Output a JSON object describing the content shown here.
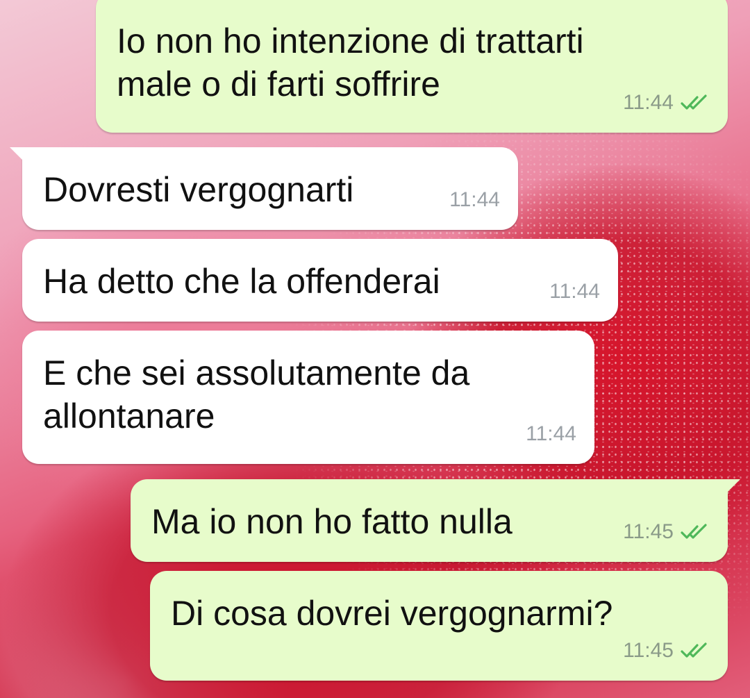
{
  "messages": [
    {
      "direction": "outgoing",
      "text": "Io non ho intenzione di trattarti\nmale o di farti soffrire",
      "time": "11:44",
      "status": "read"
    },
    {
      "direction": "incoming",
      "text": "Dovresti vergognarti",
      "time": "11:44"
    },
    {
      "direction": "incoming",
      "text": "Ha detto che la offenderai",
      "time": "11:44"
    },
    {
      "direction": "incoming",
      "text": "E che sei assolutamente da\nallontanare",
      "time": "11:44"
    },
    {
      "direction": "outgoing",
      "text": "Ma io non ho fatto nulla",
      "time": "11:45",
      "status": "read"
    },
    {
      "direction": "outgoing",
      "text": "Di cosa dovrei vergognarmi?",
      "time": "11:45",
      "status": "read"
    }
  ],
  "colors": {
    "outgoing_bubble": "#e7fccb",
    "incoming_bubble": "#ffffff",
    "read_ticks": "#4fb85a",
    "time_text": "#8a9a88"
  },
  "icons": {
    "read_status": "double-check-icon"
  }
}
